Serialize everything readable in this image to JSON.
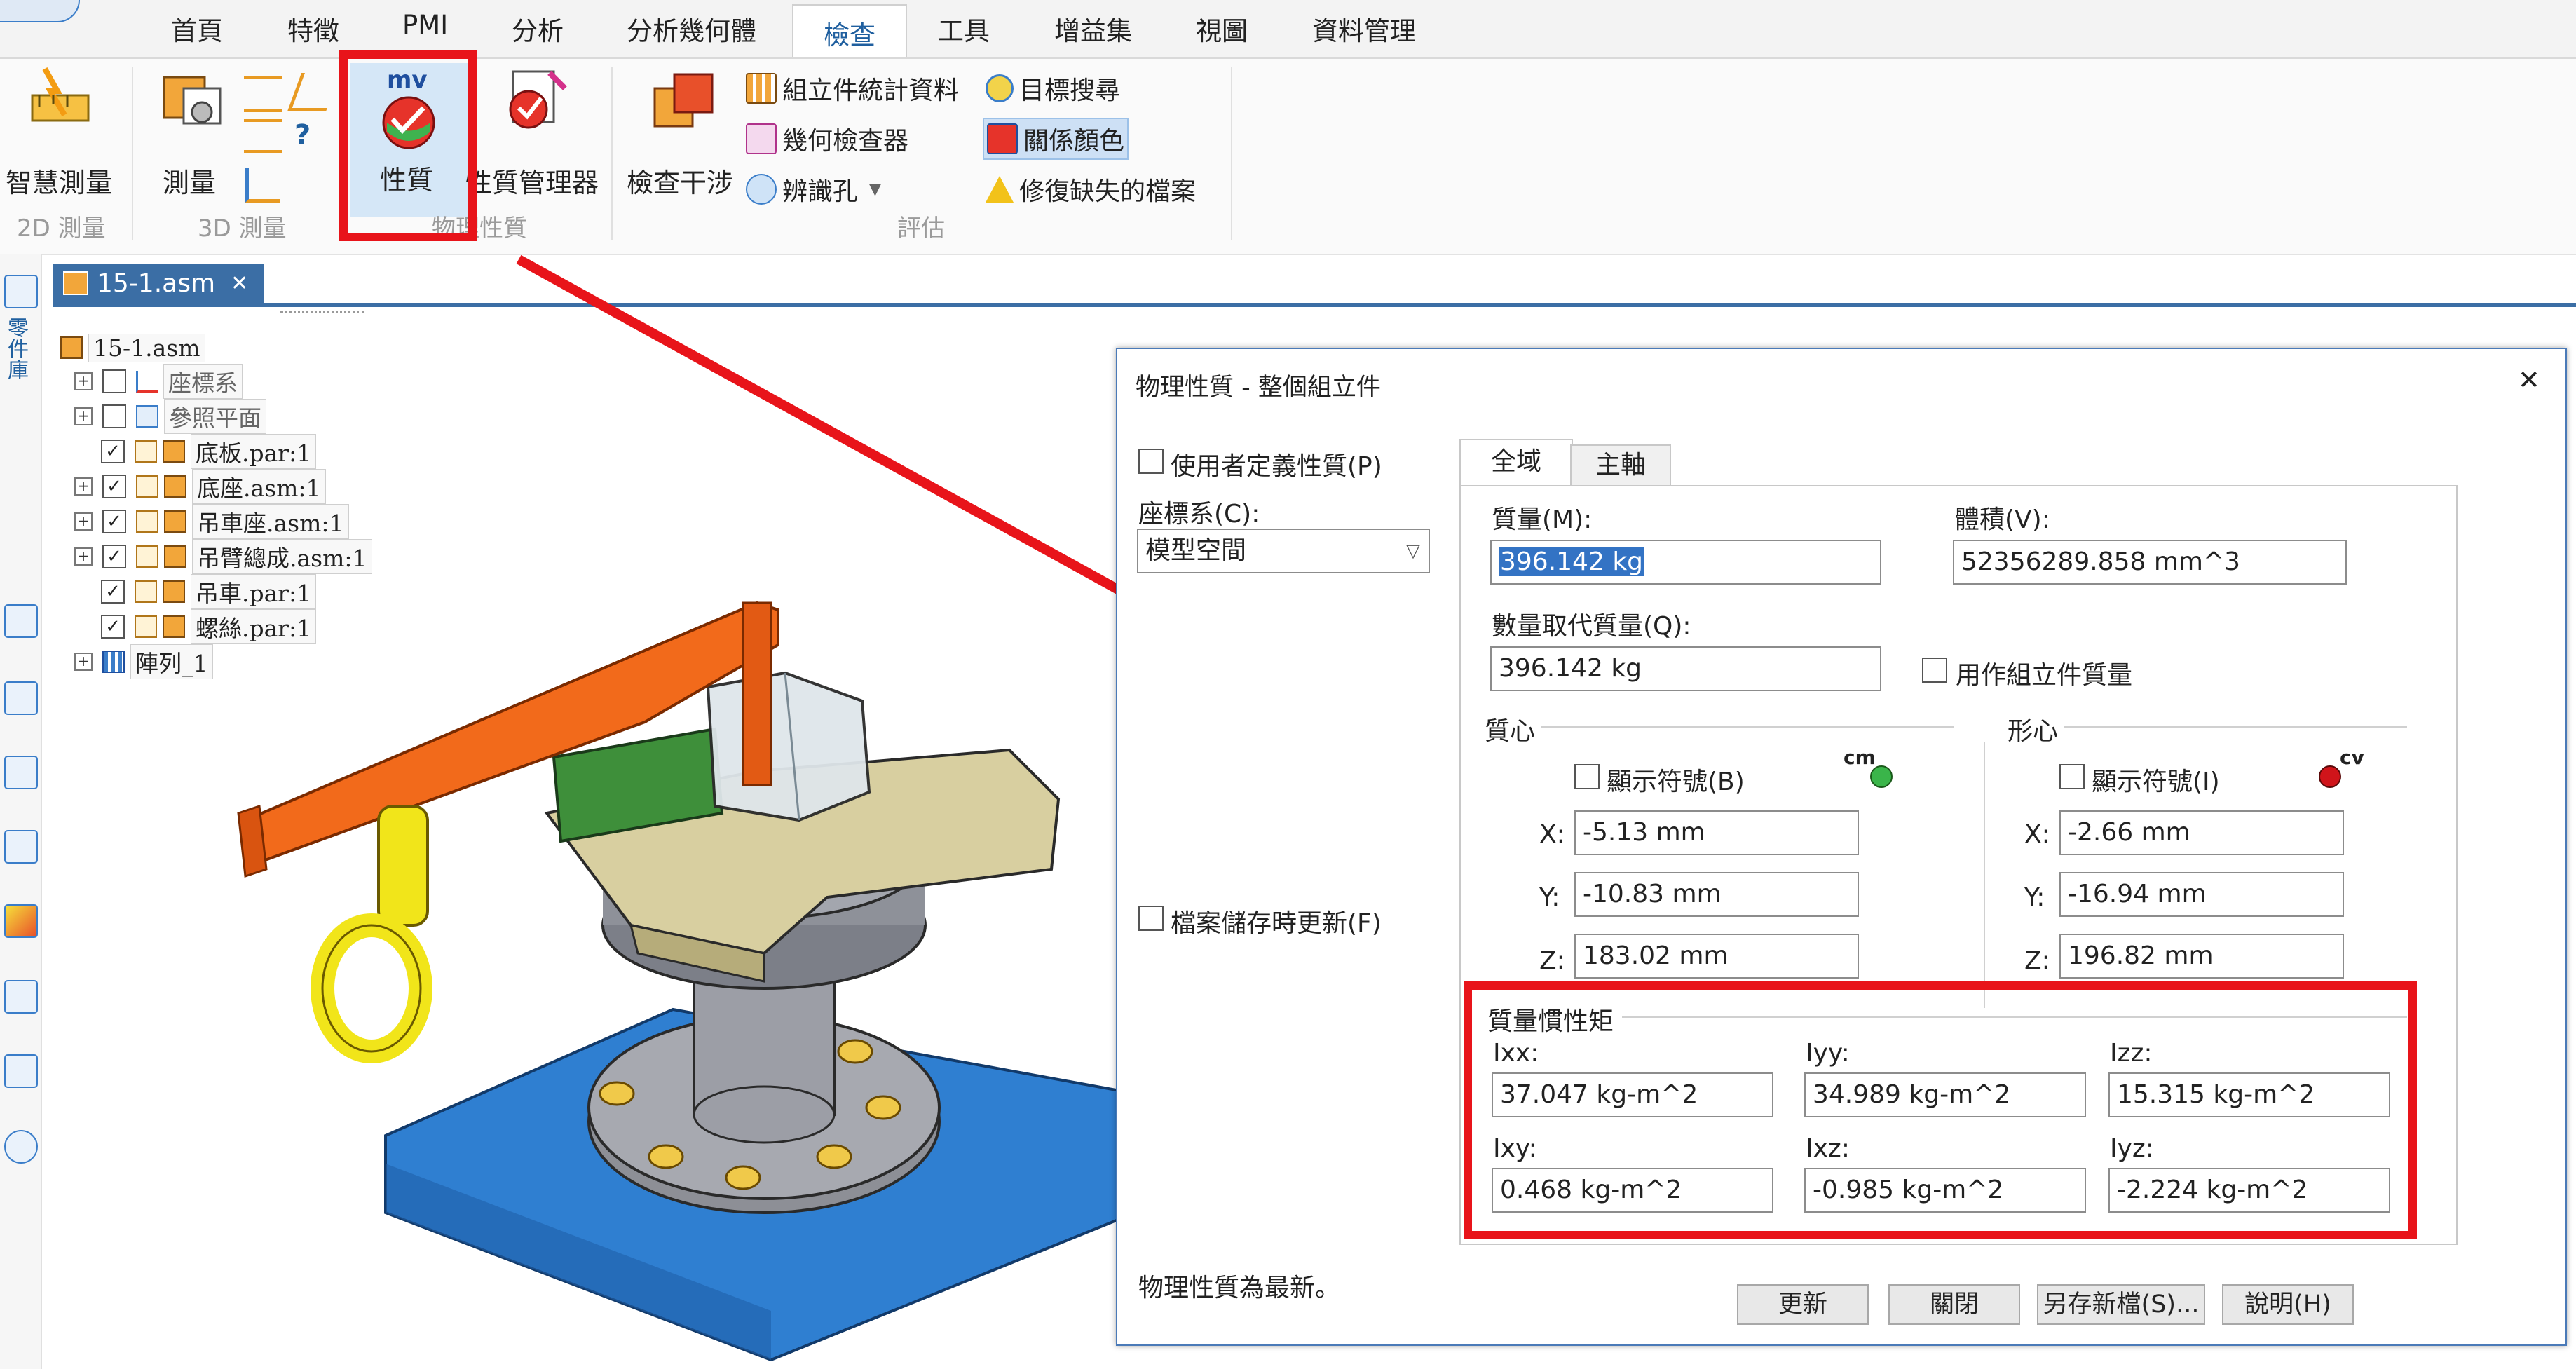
{
  "ribbon": {
    "tabs": [
      "首頁",
      "特徵",
      "PMI",
      "分析",
      "分析幾何體",
      "檢查",
      "工具",
      "增益集",
      "視圖",
      "資料管理"
    ],
    "active_tab": "檢查",
    "groups": {
      "g2d": "2D 測量",
      "g3d": "3D 測量",
      "phys": "物理性質",
      "eval": "評估"
    },
    "buttons": {
      "smart_measure": "智慧測量",
      "measure": "測量",
      "properties": "性質",
      "property_manager": "性質管理器",
      "check_interference": "檢查干涉",
      "assembly_stats": "組立件統計資料",
      "geometry_inspector": "幾何檢查器",
      "identify_holes": "辨識孔",
      "target_search": "目標搜尋",
      "relationship_color": "關係顏色",
      "repair_missing": "修復缺失的檔案"
    }
  },
  "left_strip": {
    "library_label": "零件庫"
  },
  "document": {
    "tab_title": "15-1.asm",
    "close_glyph": "✕",
    "tree": {
      "root": "15-1.asm",
      "items": [
        "座標系",
        "參照平面",
        "底板.par:1",
        "底座.asm:1",
        "吊車座.asm:1",
        "吊臂總成.asm:1",
        "吊車.par:1",
        "螺絲.par:1",
        "陣列_1"
      ]
    }
  },
  "dialog": {
    "title": "物理性質 - 整個組立件",
    "close_glyph": "✕",
    "user_defined": "使用者定義性質(P)",
    "coord_label": "座標系(C):",
    "coord_value": "模型空間",
    "update_on_save": "檔案儲存時更新(F)",
    "tabs": {
      "global": "全域",
      "principal": "主軸"
    },
    "mass_label": "質量(M):",
    "mass_value": "396.142 kg",
    "volume_label": "體積(V):",
    "volume_value": "52356289.858 mm^3",
    "mass_override_label": "數量取代質量(Q):",
    "mass_override_value": "396.142 kg",
    "use_as_assembly_mass": "用作組立件質量",
    "center_of_mass": {
      "title": "質心",
      "show_symbol": "顯示符號(B)",
      "symbol": "cm",
      "x_label": "X:",
      "x": "-5.13 mm",
      "y_label": "Y:",
      "y": "-10.83 mm",
      "z_label": "Z:",
      "z": "183.02 mm"
    },
    "centroid": {
      "title": "形心",
      "show_symbol": "顯示符號(I)",
      "symbol": "cv",
      "x_label": "X:",
      "x": "-2.66 mm",
      "y_label": "Y:",
      "y": "-16.94 mm",
      "z_label": "Z:",
      "z": "196.82 mm"
    },
    "inertia": {
      "title": "質量慣性矩",
      "ixx_label": "Ixx:",
      "ixx": "37.047 kg-m^2",
      "iyy_label": "Iyy:",
      "iyy": "34.989 kg-m^2",
      "izz_label": "Izz:",
      "izz": "15.315 kg-m^2",
      "ixy_label": "Ixy:",
      "ixy": "0.468 kg-m^2",
      "ixz_label": "Ixz:",
      "ixz": "-0.985 kg-m^2",
      "iyz_label": "Iyz:",
      "iyz": "-2.224 kg-m^2"
    },
    "status": "物理性質為最新。",
    "buttons": {
      "update": "更新",
      "close": "關閉",
      "save_as": "另存新檔(S)...",
      "help": "說明(H)"
    }
  },
  "colors": {
    "highlight_red": "#e8141a",
    "accent_blue": "#3b6ea5",
    "crane_orange": "#f26a1b",
    "hook_yellow": "#f1e51a",
    "base_blue": "#2f7fd1"
  }
}
